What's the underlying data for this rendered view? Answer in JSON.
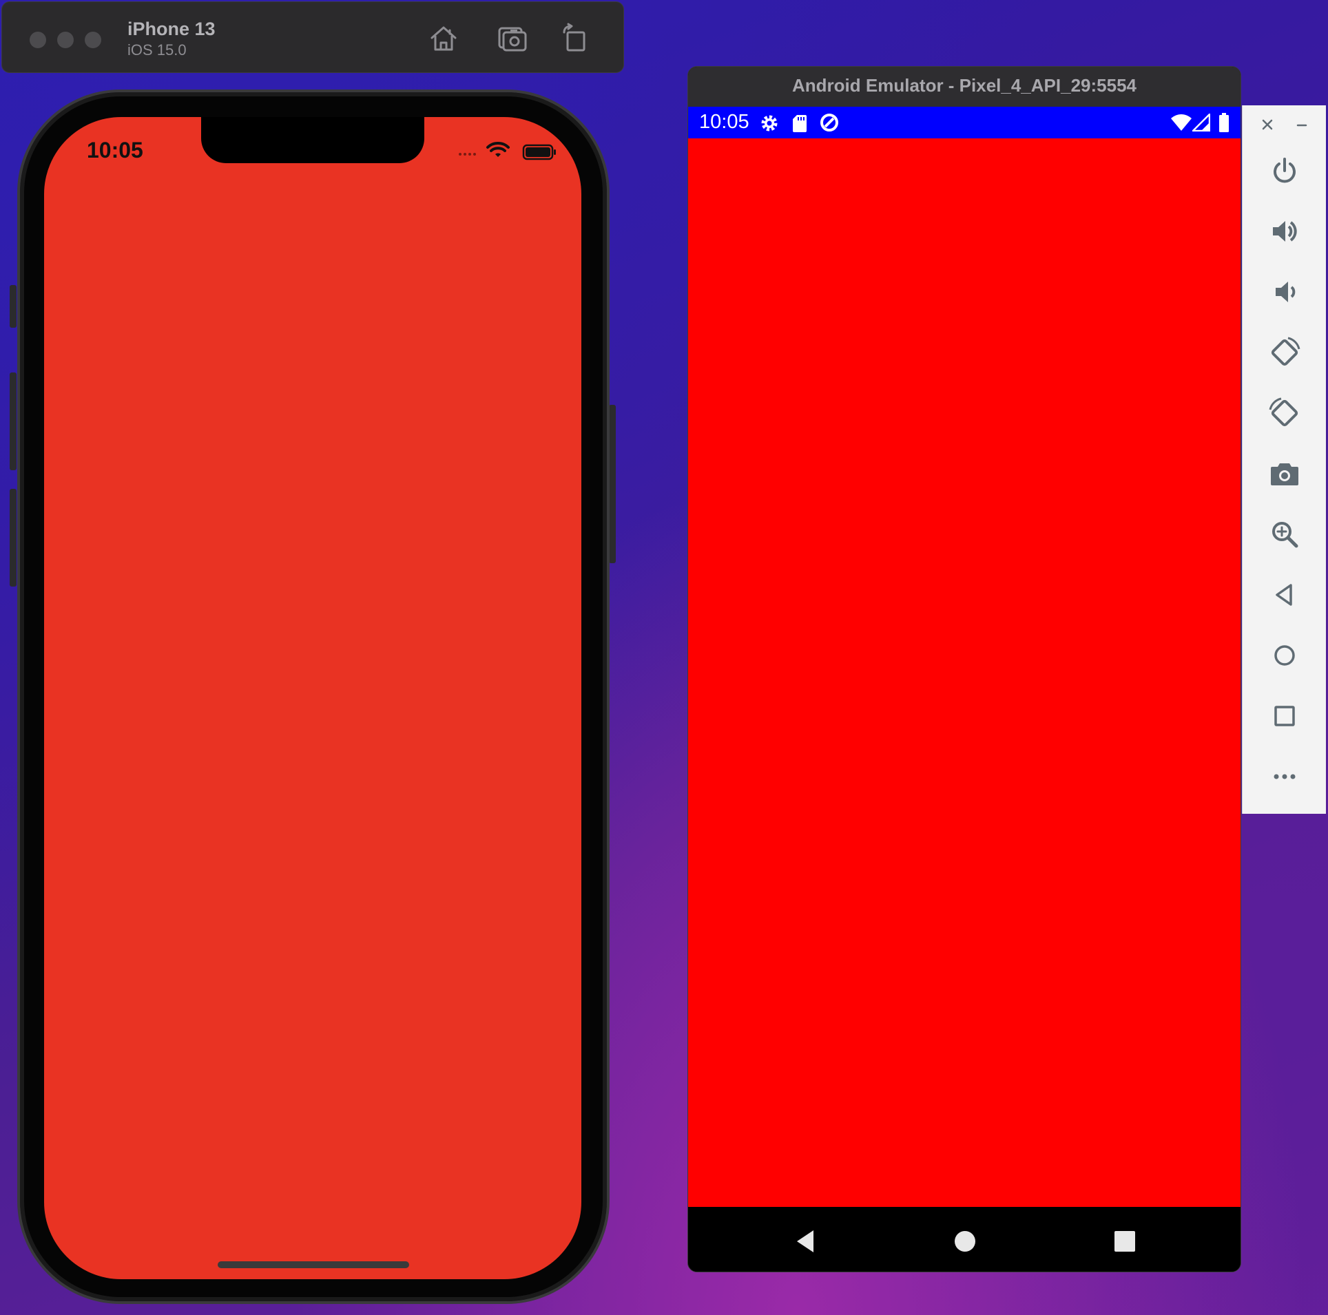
{
  "ios_simulator": {
    "device_name": "iPhone 13",
    "os_version": "iOS 15.0",
    "toolbar_buttons": [
      "home-icon",
      "screenshot-icon",
      "rotate-icon"
    ],
    "status_time": "10:05",
    "screen_color": "#e93323"
  },
  "android_emulator": {
    "window_title": "Android Emulator - Pixel_4_API_29:5554",
    "status_time": "10:05",
    "status_bar_color": "#0000ff",
    "screen_color": "#ff0000",
    "nav_buttons": [
      "back-icon",
      "home-icon",
      "recents-icon"
    ],
    "side_controls": [
      "close-icon",
      "minimize-icon",
      "power-icon",
      "volume-up-icon",
      "volume-down-icon",
      "rotate-left-icon",
      "rotate-right-icon",
      "camera-icon",
      "zoom-icon",
      "back-icon",
      "home-icon",
      "overview-icon",
      "more-icon"
    ]
  }
}
